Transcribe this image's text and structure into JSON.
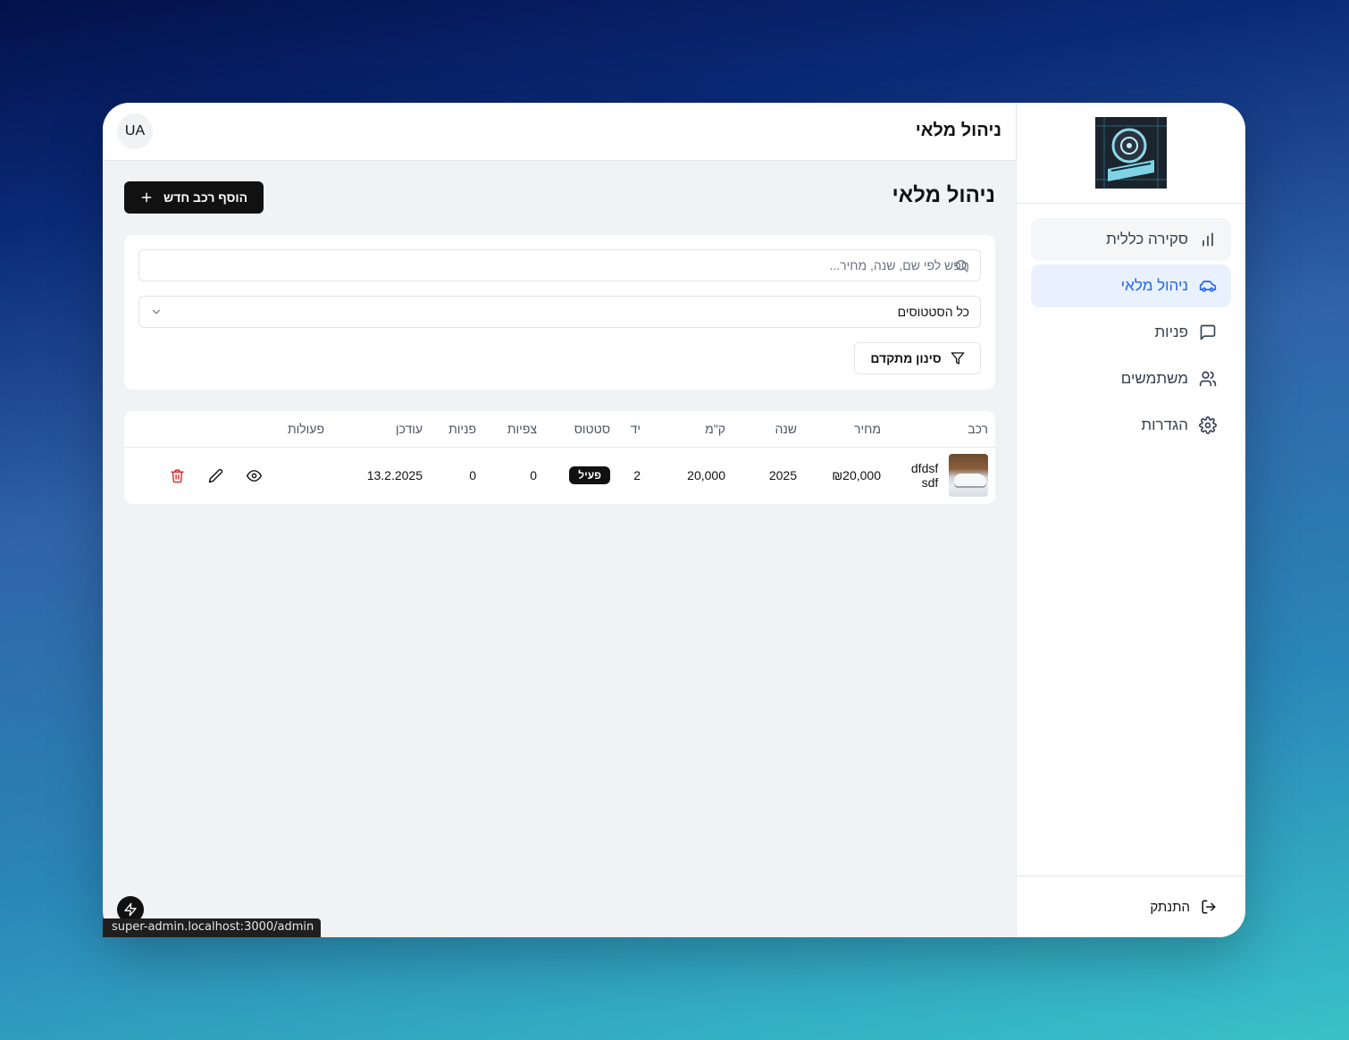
{
  "topbar": {
    "title": "ניהול מלאי",
    "avatar": "UA"
  },
  "sidebar": {
    "items": [
      {
        "label": "סקירה כללית",
        "icon": "bar-chart-icon"
      },
      {
        "label": "ניהול מלאי",
        "icon": "car-icon"
      },
      {
        "label": "פניות",
        "icon": "message-square-icon"
      },
      {
        "label": "משתמשים",
        "icon": "users-icon"
      },
      {
        "label": "הגדרות",
        "icon": "gear-icon"
      }
    ],
    "active_index": 1,
    "logout_label": "התנתק"
  },
  "main": {
    "title": "ניהול מלאי",
    "add_button": "הוסף רכב חדש",
    "search_placeholder": "חפש לפי שם, שנה, מחיר...",
    "status_select": "כל הסטטוסים",
    "advanced_filter": "סינון מתקדם"
  },
  "table": {
    "headers": [
      "רכב",
      "מחיר",
      "שנה",
      "ק\"מ",
      "יד",
      "סטטוס",
      "צפיות",
      "פניות",
      "עודכן",
      "פעולות"
    ],
    "rows": [
      {
        "name": "dfdsf sdf",
        "price": "₪20,000",
        "year": "2025",
        "km": "20,000",
        "hand": "2",
        "status": "פעיל",
        "views": "0",
        "inquiries": "0",
        "updated": "13.2.2025"
      }
    ]
  },
  "status_bar_url": "super-admin.localhost:3000/admin",
  "colors": {
    "accent": "#2563eb",
    "danger": "#dc2626",
    "dark": "#111111"
  }
}
